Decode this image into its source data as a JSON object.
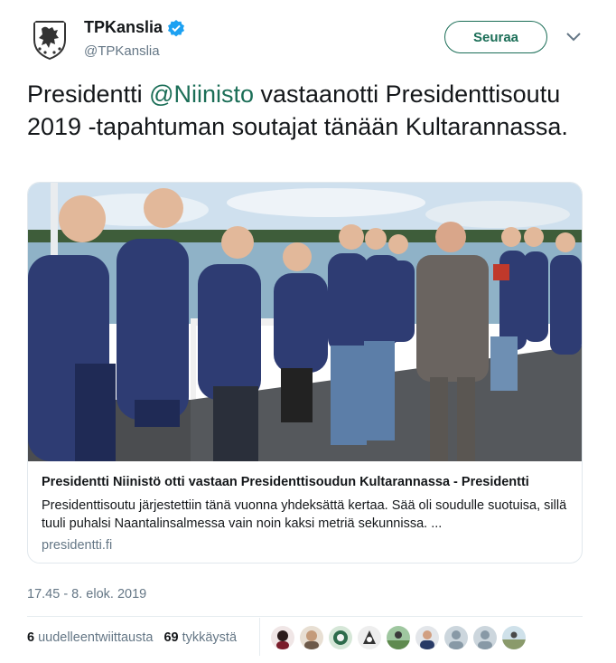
{
  "tweet": {
    "author_name": "TPKanslia",
    "author_handle": "@TPKanslia",
    "follow_label": "Seuraa",
    "text_before": "Presidentti ",
    "mention": "@Niinisto",
    "text_after": " vastaanotti Presidenttisoutu 2019 -tapahtuman soutajat tänään Kultarannassa.",
    "timestamp": "17.45 - 8. elok. 2019",
    "accent_color": "#1b6e57"
  },
  "card": {
    "title": "Presidentti Niinistö otti vastaan Presidenttisoudun Kultarannassa - Presidentti",
    "description": "Presidenttisoutu järjestettiin tänä vuonna yhdeksättä kertaa. Sää oli soudulle suotuisa, sillä tuuli puhalsi Naantalinsalmessa vain noin kaksi metriä sekunnissa. ...",
    "domain": "presidentti.fi"
  },
  "stats": {
    "retweets_count": "6",
    "retweets_label": "uudelleentwiittausta",
    "likes_count": "69",
    "likes_label": "tykkäystä"
  },
  "icons": {
    "avatar": "coat-of-arms-icon",
    "verified": "verified-badge-icon",
    "caret": "chevron-down-icon"
  },
  "likers": [
    "liker-1",
    "liker-2",
    "liker-3",
    "liker-4",
    "liker-5",
    "liker-6",
    "liker-7",
    "liker-8",
    "liker-9"
  ]
}
